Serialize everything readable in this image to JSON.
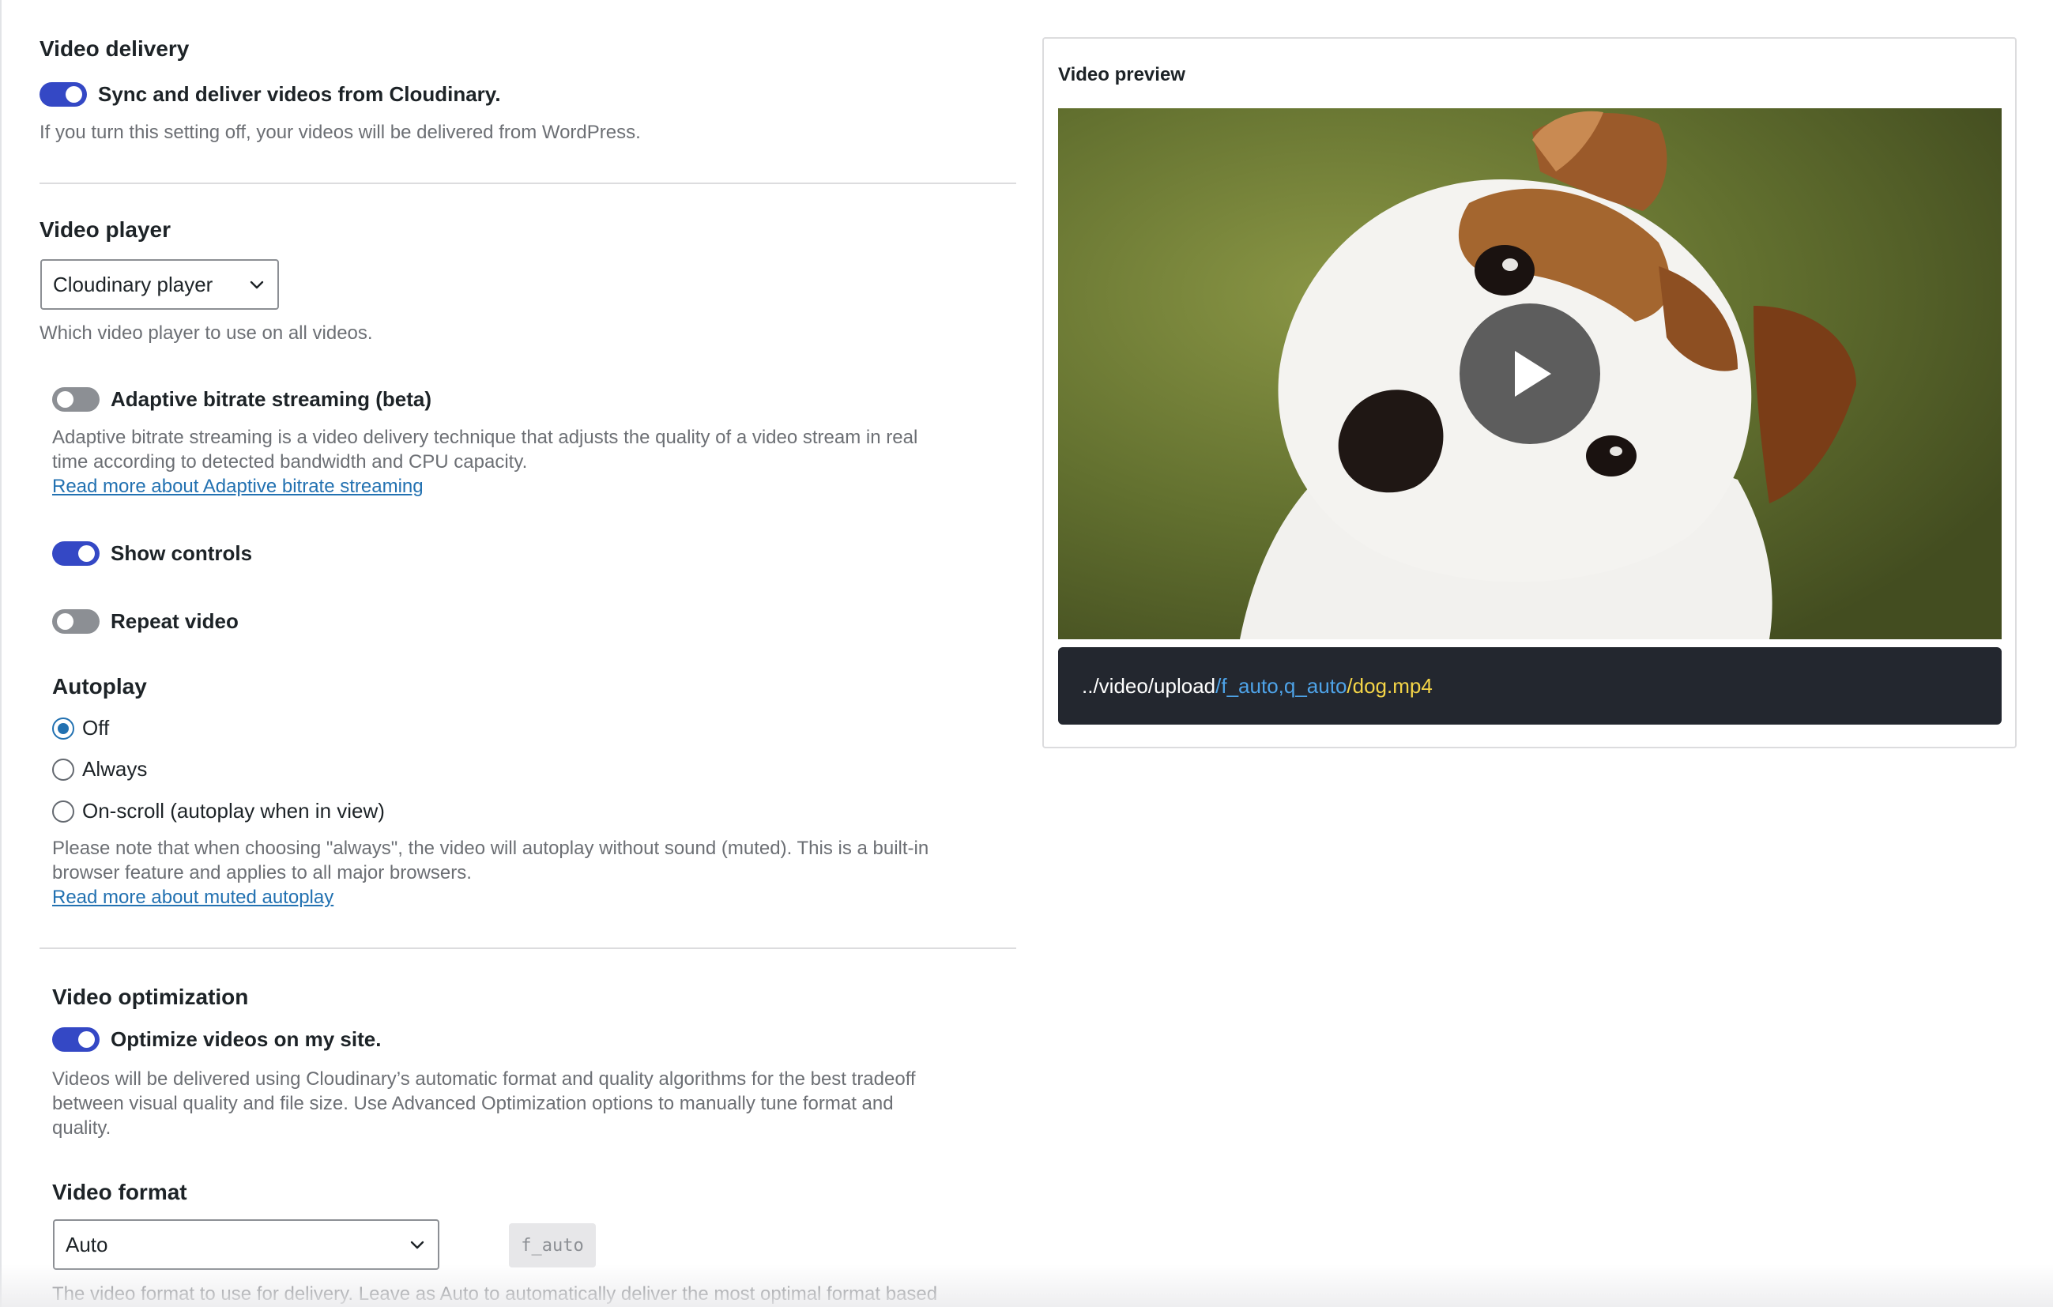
{
  "video_delivery": {
    "title": "Video delivery",
    "sync_toggle_label": "Sync and deliver videos from Cloudinary.",
    "sync_enabled": true,
    "sync_description": "If you turn this setting off, your videos will be delivered from WordPress."
  },
  "video_player": {
    "title": "Video player",
    "player_select_value": "Cloudinary player",
    "player_description": "Which video player to use on all videos.",
    "adaptive_label": "Adaptive bitrate streaming (beta)",
    "adaptive_enabled": false,
    "adaptive_description_line1": "Adaptive bitrate streaming is a video delivery technique that adjusts the quality of a video stream in real",
    "adaptive_description_line2": "time according to detected bandwidth and CPU capacity.",
    "adaptive_link": "Read more about Adaptive bitrate streaming",
    "show_controls_label": "Show controls",
    "show_controls_enabled": true,
    "repeat_label": "Repeat video",
    "repeat_enabled": false
  },
  "autoplay": {
    "title": "Autoplay",
    "options": [
      "Off",
      "Always",
      "On-scroll (autoplay when in view)"
    ],
    "selected": "Off",
    "note_line1": "Please note that when choosing \"always\", the video will autoplay without sound (muted). This is a built-in",
    "note_line2": "browser feature and applies to all major browsers.",
    "link": "Read more about muted autoplay"
  },
  "video_optimization": {
    "title": "Video optimization",
    "optimize_label": "Optimize videos on my site.",
    "optimize_enabled": true,
    "description_line1": "Videos will be delivered using Cloudinary’s automatic format and quality algorithms for the best tradeoff",
    "description_line2": "between visual quality and file size. Use Advanced Optimization options to manually tune format and",
    "description_line3": "quality."
  },
  "video_format": {
    "title": "Video format",
    "select_value": "Auto",
    "code_chip": "f_auto",
    "description": "The video format to use for delivery. Leave as Auto to automatically deliver the most optimal format based"
  },
  "preview": {
    "title": "Video preview",
    "url_base": "../video/upload",
    "url_transform": "/f_auto,q_auto",
    "url_file": "/dog.mp4"
  },
  "icons": {
    "play": "play-icon",
    "chevron": "chevron-down-icon"
  },
  "colors": {
    "accent": "#3448c5",
    "link": "#2271b1",
    "url_transform": "#4ea3e8",
    "url_file": "#f5d547",
    "url_bar_bg": "#23272f"
  }
}
